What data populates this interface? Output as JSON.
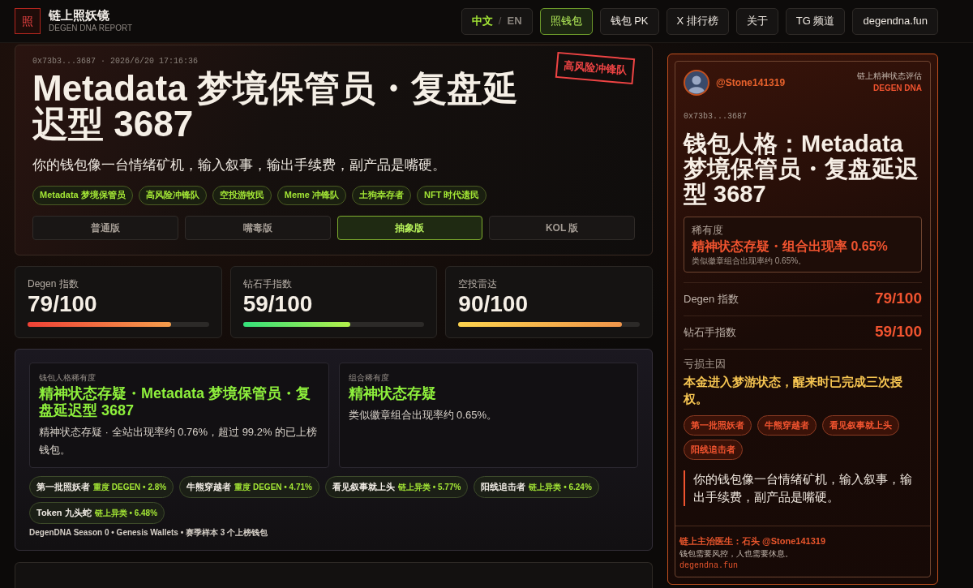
{
  "header": {
    "logo": "照",
    "title": "链上照妖镜",
    "subtitle": "DEGEN DNA REPORT",
    "language": {
      "separator": "/",
      "options": [
        {
          "label": "中文",
          "selected": true
        },
        {
          "label": "EN",
          "selected": false
        }
      ]
    },
    "nav": [
      {
        "label": "照钱包",
        "selected": true
      },
      {
        "label": "钱包 PK",
        "selected": false
      },
      {
        "label": "X 排行榜",
        "selected": false
      },
      {
        "label": "关于",
        "selected": false
      },
      {
        "label": "TG 频道",
        "selected": false
      },
      {
        "label": "degendna.fun",
        "selected": false
      }
    ]
  },
  "hero": {
    "meta": "0x73b3...3687 · 2026/6/20 17:16:36",
    "title": "Metadata 梦境保管员・复盘延迟型 3687",
    "stamp": "高风险冲锋队",
    "tagline": "你的钱包像一台情绪矿机，输入叙事，输出手续费，副产品是嘴硬。",
    "tags": [
      "Metadata 梦境保管员",
      "高风险冲锋队",
      "空投游牧民",
      "Meme 冲锋队",
      "土狗幸存者",
      "NFT 时代遗民"
    ],
    "versions": [
      {
        "label": "普通版",
        "selected": false
      },
      {
        "label": "嘴毒版",
        "selected": false
      },
      {
        "label": "抽象版",
        "selected": true
      },
      {
        "label": "KOL 版",
        "selected": false
      }
    ]
  },
  "stats": [
    {
      "label": "Degen 指数",
      "value": "79/100",
      "level": 0.79,
      "kind": "heat"
    },
    {
      "label": "钻石手指数",
      "value": "59/100",
      "level": 0.59,
      "kind": "growth"
    },
    {
      "label": "空投雷达",
      "value": "90/100",
      "level": 0.9,
      "kind": "gold"
    }
  ],
  "rarity": {
    "cards": [
      {
        "label": "钱包人格稀有度",
        "title": "精神状态存疑・Metadata 梦境保管员・复盘延迟型 3687",
        "description": "精神状态存疑 · 全站出现率约 0.76%，超过 99.2% 的已上榜钱包。"
      },
      {
        "label": "组合稀有度",
        "title": "精神状态存疑",
        "description": "类似徽章组合出现率约 0.65%。"
      }
    ],
    "badges": [
      {
        "name": "第一批照妖者",
        "detail": "重度 DEGEN • 2.8%"
      },
      {
        "name": "牛熊穿越者",
        "detail": "重度 DEGEN • 4.71%"
      },
      {
        "name": "看见叙事就上头",
        "detail": "链上异类 • 5.77%"
      },
      {
        "name": "阳线追击者",
        "detail": "链上异类 • 6.24%"
      },
      {
        "name": "Token 九头蛇",
        "detail": "链上异类 • 6.48%"
      }
    ],
    "footer": "DegenDNA Season 0 • Genesis Wallets • 赛季样本 3 个上榜钱包"
  },
  "share_card": {
    "handle": "@Stone141319",
    "eyebrow": "链上精神状态评估",
    "brand": "DEGEN DNA",
    "address": "0x73b3...3687",
    "title": "钱包人格：Metadata 梦境保管员・复盘延迟型 3687",
    "rarity": {
      "label": "稀有度",
      "title": "精神状态存疑・组合出现率 0.65%",
      "note": "类似徽章组合出现率约 0.65%。"
    },
    "scores": [
      {
        "label": "Degen 指数",
        "value": "79/100"
      },
      {
        "label": "钻石手指数",
        "value": "59/100"
      }
    ],
    "loss": {
      "label": "亏损主因",
      "text": "本金进入梦游状态，醒来时已完成三次授权。"
    },
    "tags": [
      "第一批照妖者",
      "牛熊穿越者",
      "看见叙事就上头",
      "阳线追击者"
    ],
    "quote": "你的钱包像一台情绪矿机，输入叙事，输出手续费，副产品是嘴硬。",
    "footer": {
      "credit": "链上主治医生：石头 @Stone141319",
      "motto": "钱包需要风控，人也需要休息。",
      "site": "degendna.fun"
    }
  }
}
